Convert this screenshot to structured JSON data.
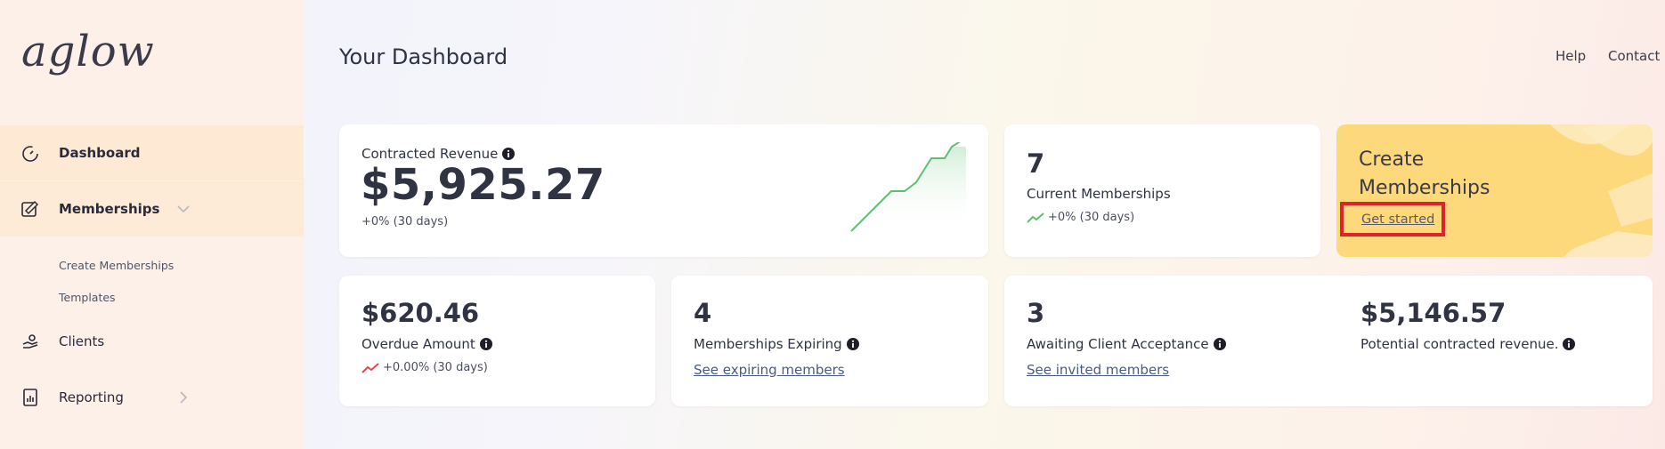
{
  "brand": {
    "logo": "aglow"
  },
  "sidebar": {
    "items": [
      {
        "label": "Dashboard",
        "icon": "dashboard-icon"
      },
      {
        "label": "Memberships",
        "icon": "memberships-icon"
      },
      {
        "label": "Clients",
        "icon": "clients-icon"
      },
      {
        "label": "Reporting",
        "icon": "reporting-icon"
      }
    ],
    "sub_items": [
      {
        "label": "Create Memberships"
      },
      {
        "label": "Templates"
      }
    ]
  },
  "header": {
    "title": "Your Dashboard",
    "links": [
      {
        "label": "Help"
      },
      {
        "label": "Contact"
      }
    ]
  },
  "cards": {
    "revenue": {
      "label": "Contracted Revenue",
      "value": "$5,925.27",
      "change": "+0% (30 days)"
    },
    "current": {
      "value": "7",
      "label": "Current Memberships",
      "change": "+0% (30 days)"
    },
    "promo": {
      "title": "Create Memberships",
      "link": "Get started"
    },
    "overdue": {
      "value": "$620.46",
      "label": "Overdue Amount",
      "change": "+0.00% (30 days)"
    },
    "expiring": {
      "value": "4",
      "label": "Memberships Expiring",
      "link": "See expiring members"
    },
    "awaiting": {
      "value": "3",
      "label": "Awaiting Client Acceptance",
      "link": "See invited members"
    },
    "potential": {
      "value": "$5,146.57",
      "label": "Potential contracted revenue."
    }
  },
  "colors": {
    "trend_green": "#5cc070",
    "trend_red": "#e4474f",
    "promo_bg": "#fdd97b",
    "highlight": "#e0222a"
  }
}
